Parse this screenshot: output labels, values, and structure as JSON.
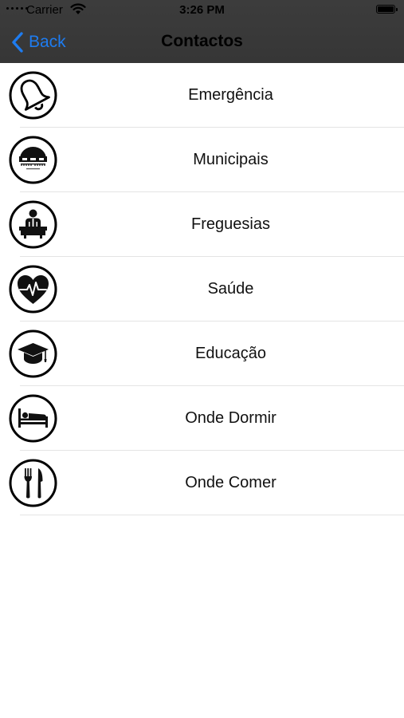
{
  "status_bar": {
    "carrier": "Carrier",
    "time": "3:26 PM"
  },
  "nav": {
    "back_label": "Back",
    "title": "Contactos"
  },
  "colors": {
    "header_bg": "#3a3a3a",
    "accent": "#1e7cf0",
    "divider": "#e4e4e4"
  },
  "items": [
    {
      "label": "Emergência",
      "icon": "bell-icon"
    },
    {
      "label": "Municipais",
      "icon": "municipal-logo-icon"
    },
    {
      "label": "Freguesias",
      "icon": "person-desk-icon"
    },
    {
      "label": "Saúde",
      "icon": "heart-pulse-icon"
    },
    {
      "label": "Educação",
      "icon": "graduation-cap-icon"
    },
    {
      "label": "Onde Dormir",
      "icon": "bed-icon"
    },
    {
      "label": "Onde Comer",
      "icon": "fork-knife-icon"
    }
  ]
}
